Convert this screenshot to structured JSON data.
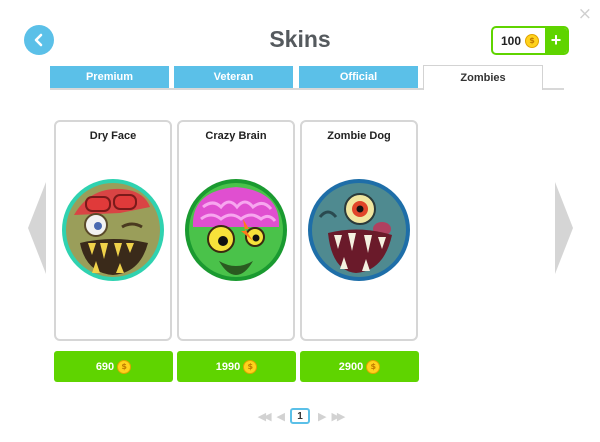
{
  "header": {
    "title": "Skins",
    "close_glyph": "×",
    "back_icon": "chevron-left-icon",
    "coins": {
      "value": "100",
      "coin_symbol": "$",
      "plus_label": "+"
    }
  },
  "tabs": [
    {
      "label": "Premium",
      "active": false
    },
    {
      "label": "Veteran",
      "active": false
    },
    {
      "label": "Official",
      "active": false
    },
    {
      "label": "Zombies",
      "active": true
    }
  ],
  "skins": [
    {
      "name": "Dry Face",
      "price": "690",
      "coin_symbol": "$",
      "icon": "zombie-dry-face-icon"
    },
    {
      "name": "Crazy Brain",
      "price": "1990",
      "coin_symbol": "$",
      "icon": "zombie-crazy-brain-icon"
    },
    {
      "name": "Zombie Dog",
      "price": "2900",
      "coin_symbol": "$",
      "icon": "zombie-dog-icon"
    }
  ],
  "pagination": {
    "first": "◀◀",
    "prev": "◀",
    "current": "1",
    "next": "▶",
    "last": "▶▶"
  },
  "colors": {
    "accent_blue": "#5bc0e8",
    "accent_green": "#5fd400",
    "coin_gold": "#ffd21c",
    "title_gray": "#555a5e"
  }
}
